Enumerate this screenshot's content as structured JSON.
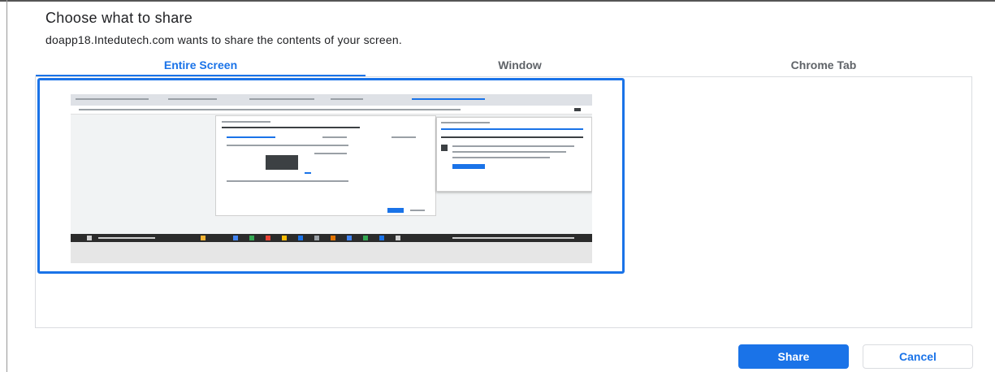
{
  "dialog": {
    "title": "Choose what to share",
    "subtitle": "doapp18.Intedutech.com wants to share the contents of your screen."
  },
  "tabs": [
    {
      "label": "Entire Screen",
      "active": true
    },
    {
      "label": "Window",
      "active": false
    },
    {
      "label": "Chrome Tab",
      "active": false
    }
  ],
  "buttons": {
    "share_label": "Share",
    "cancel_label": "Cancel"
  },
  "colors": {
    "accent": "#1a73e8",
    "text": "#202124",
    "tab_inactive": "#5f6368",
    "border": "#dadce0"
  }
}
